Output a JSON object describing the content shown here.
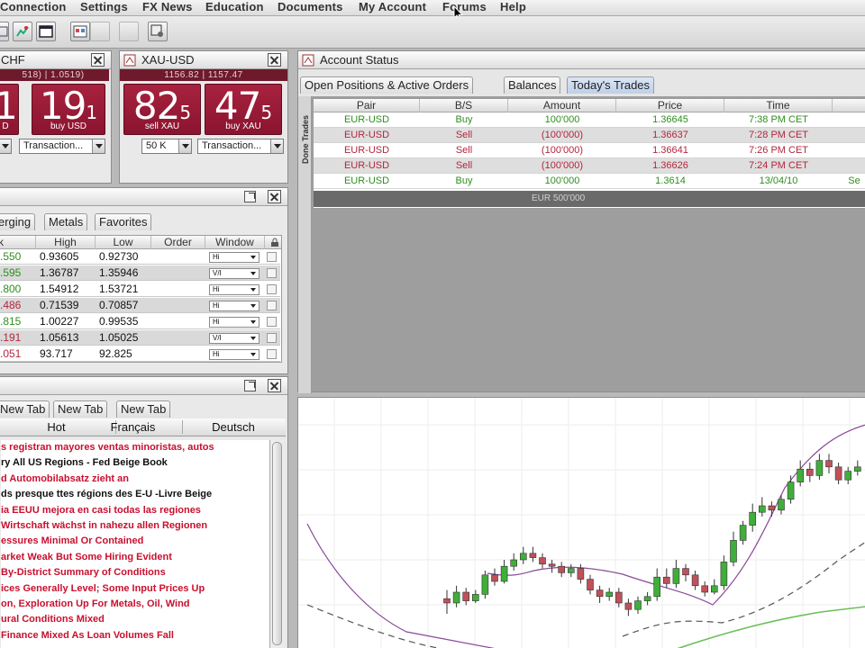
{
  "menu": [
    "Connection",
    "Settings",
    "FX News",
    "Education",
    "Documents",
    "My Account",
    "Forums",
    "Help"
  ],
  "tile_chf": {
    "title": "CHF",
    "rates": "518) | 1.0519)",
    "sell_big": "1",
    "buy_big": "19",
    "buy_small": "1",
    "sell_label": "D",
    "buy_label": "buy USD",
    "combo_value": "Transaction..."
  },
  "tile_xau": {
    "title": "XAU-USD",
    "rates": "1156.82 | 1157.47",
    "sell_big": "82",
    "sell_small": "5",
    "buy_big": "47",
    "buy_small": "5",
    "sell_label": "sell XAU",
    "buy_label": "buy XAU",
    "amount": "50 K",
    "combo_value": "Transaction..."
  },
  "account": {
    "title": "Account Status",
    "tabs": [
      "Open Positions & Active Orders",
      "Balances",
      "Today's Trades"
    ],
    "active_tab": "Today's Trades",
    "side_label": "Done Trades",
    "columns": [
      "Pair",
      "B/S",
      "Amount",
      "Price",
      "Time"
    ],
    "rows": [
      {
        "pair": "EUR-USD",
        "side": "Buy",
        "amount": "100'000",
        "price": "1.36645",
        "time": "7:38 PM CET",
        "color": "#2f8e1e"
      },
      {
        "pair": "EUR-USD",
        "side": "Sell",
        "amount": "(100'000)",
        "price": "1.36637",
        "time": "7:28 PM CET",
        "color": "#b3263d"
      },
      {
        "pair": "EUR-USD",
        "side": "Sell",
        "amount": "(100'000)",
        "price": "1.36641",
        "time": "7:26 PM CET",
        "color": "#b3263d"
      },
      {
        "pair": "EUR-USD",
        "side": "Sell",
        "amount": "(100'000)",
        "price": "1.36626",
        "time": "7:24 PM CET",
        "color": "#b3263d"
      },
      {
        "pair": "EUR-USD",
        "side": "Buy",
        "amount": "100'000",
        "price": "1.3614",
        "time": "13/04/10",
        "extra": "Se",
        "color": "#2f8e1e"
      }
    ],
    "total": "EUR 500'000"
  },
  "market": {
    "tabs": [
      "erging",
      "Metals",
      "Favorites"
    ],
    "columns": [
      "k",
      "High",
      "Low",
      "Order",
      "Window"
    ],
    "rows": [
      {
        "bid": ".550",
        "high": "0.93605",
        "low": "0.92730",
        "window": "Hi",
        "color": "#2f8e1e"
      },
      {
        "bid": ".595",
        "high": "1.36787",
        "low": "1.35946",
        "window": "V/I",
        "color": "#2f8e1e"
      },
      {
        "bid": ".800",
        "high": "1.54912",
        "low": "1.53721",
        "window": "Hi",
        "color": "#2f8e1e"
      },
      {
        "bid": ".486",
        "high": "0.71539",
        "low": "0.70857",
        "window": "Hi",
        "color": "#b3263d"
      },
      {
        "bid": ".815",
        "high": "1.00227",
        "low": "0.99535",
        "window": "Hi",
        "color": "#2f8e1e"
      },
      {
        "bid": ".191",
        "high": "1.05613",
        "low": "1.05025",
        "window": "V/I",
        "color": "#b3263d"
      },
      {
        "bid": ".051",
        "high": "93.717",
        "low": "92.825",
        "window": "Hi",
        "color": "#b3263d"
      }
    ]
  },
  "news": {
    "tabs": [
      "New Tab",
      "New Tab",
      "New Tab"
    ],
    "sub_tabs": [
      "Hot",
      "Français",
      "Deutsch"
    ],
    "items": [
      {
        "text": "s registran mayores ventas minoristas, autos",
        "color": "#c8102e"
      },
      {
        "text": "ry All US Regions - Fed Beige Book",
        "color": "#111111"
      },
      {
        "text": "d Automobilabsatz zieht an",
        "color": "#c8102e"
      },
      {
        "text": "ds presque ttes régions des E-U -Livre Beige",
        "color": "#111111"
      },
      {
        "text": "ia EEUU mejora en casi todas las regiones",
        "color": "#c8102e"
      },
      {
        "text": "Wirtschaft wächst in nahezu allen Regionen",
        "color": "#c8102e"
      },
      {
        "text": "essures Minimal Or Contained",
        "color": "#c8102e"
      },
      {
        "text": "arket Weak But Some Hiring Evident",
        "color": "#c8102e"
      },
      {
        "text": "By-District Summary of Conditions",
        "color": "#c8102e"
      },
      {
        "text": "ices Generally Level; Some Input Prices Up",
        "color": "#c8102e"
      },
      {
        "text": "on, Exploration Up For Metals, Oil, Wind",
        "color": "#c8102e"
      },
      {
        "text": "ural Conditions Mixed",
        "color": "#c8102e"
      },
      {
        "text": "Finance Mixed As Loan Volumes Fall",
        "color": "#c8102e"
      }
    ]
  },
  "candles": [
    [
      0.32,
      0.3,
      0.36,
      0.25
    ],
    [
      0.3,
      0.35,
      0.38,
      0.28
    ],
    [
      0.35,
      0.31,
      0.37,
      0.29
    ],
    [
      0.31,
      0.34,
      0.36,
      0.3
    ],
    [
      0.34,
      0.43,
      0.45,
      0.32
    ],
    [
      0.43,
      0.4,
      0.46,
      0.38
    ],
    [
      0.4,
      0.47,
      0.5,
      0.39
    ],
    [
      0.47,
      0.5,
      0.53,
      0.45
    ],
    [
      0.5,
      0.53,
      0.56,
      0.48
    ],
    [
      0.53,
      0.51,
      0.56,
      0.49
    ],
    [
      0.51,
      0.48,
      0.53,
      0.46
    ],
    [
      0.48,
      0.47,
      0.5,
      0.44
    ],
    [
      0.47,
      0.44,
      0.49,
      0.42
    ],
    [
      0.44,
      0.46,
      0.48,
      0.42
    ],
    [
      0.46,
      0.41,
      0.48,
      0.39
    ],
    [
      0.41,
      0.36,
      0.43,
      0.34
    ],
    [
      0.36,
      0.33,
      0.38,
      0.3
    ],
    [
      0.33,
      0.35,
      0.37,
      0.31
    ],
    [
      0.35,
      0.3,
      0.37,
      0.28
    ],
    [
      0.3,
      0.27,
      0.32,
      0.24
    ],
    [
      0.27,
      0.31,
      0.33,
      0.25
    ],
    [
      0.31,
      0.33,
      0.35,
      0.29
    ],
    [
      0.33,
      0.42,
      0.46,
      0.31
    ],
    [
      0.42,
      0.39,
      0.46,
      0.37
    ],
    [
      0.39,
      0.46,
      0.5,
      0.37
    ],
    [
      0.46,
      0.43,
      0.48,
      0.4
    ],
    [
      0.43,
      0.38,
      0.45,
      0.36
    ],
    [
      0.38,
      0.35,
      0.4,
      0.33
    ],
    [
      0.35,
      0.38,
      0.41,
      0.34
    ],
    [
      0.38,
      0.49,
      0.52,
      0.36
    ],
    [
      0.49,
      0.59,
      0.63,
      0.47
    ],
    [
      0.59,
      0.66,
      0.68,
      0.57
    ],
    [
      0.66,
      0.72,
      0.76,
      0.63
    ],
    [
      0.72,
      0.75,
      0.79,
      0.7
    ],
    [
      0.75,
      0.73,
      0.77,
      0.7
    ],
    [
      0.73,
      0.78,
      0.8,
      0.71
    ],
    [
      0.78,
      0.86,
      0.89,
      0.76
    ],
    [
      0.86,
      0.92,
      0.96,
      0.84
    ],
    [
      0.92,
      0.89,
      0.95,
      0.86
    ],
    [
      0.89,
      0.96,
      0.99,
      0.87
    ],
    [
      0.96,
      0.93,
      0.99,
      0.9
    ],
    [
      0.93,
      0.87,
      0.95,
      0.85
    ],
    [
      0.87,
      0.91,
      0.93,
      0.85
    ],
    [
      0.91,
      0.93,
      0.96,
      0.89
    ]
  ],
  "colors": {
    "bull": "#3fae3a",
    "bear": "#c0505a",
    "tile": "#9a1b36"
  }
}
